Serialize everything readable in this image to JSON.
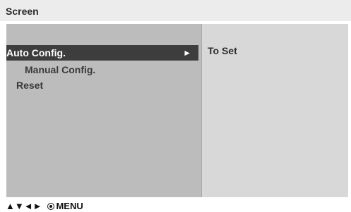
{
  "header": {
    "title": "Screen"
  },
  "menu": {
    "items": [
      {
        "label": "Auto Config.",
        "selected": true,
        "arrow": "►"
      },
      {
        "label": "Manual Config.",
        "selected": false
      },
      {
        "label": "Reset",
        "selected": false
      }
    ]
  },
  "detail": {
    "text": "To Set"
  },
  "footer": {
    "nav_arrows": "▲▼◄►",
    "ok_icon": "ok-circle-icon",
    "menu_label": "MENU"
  }
}
